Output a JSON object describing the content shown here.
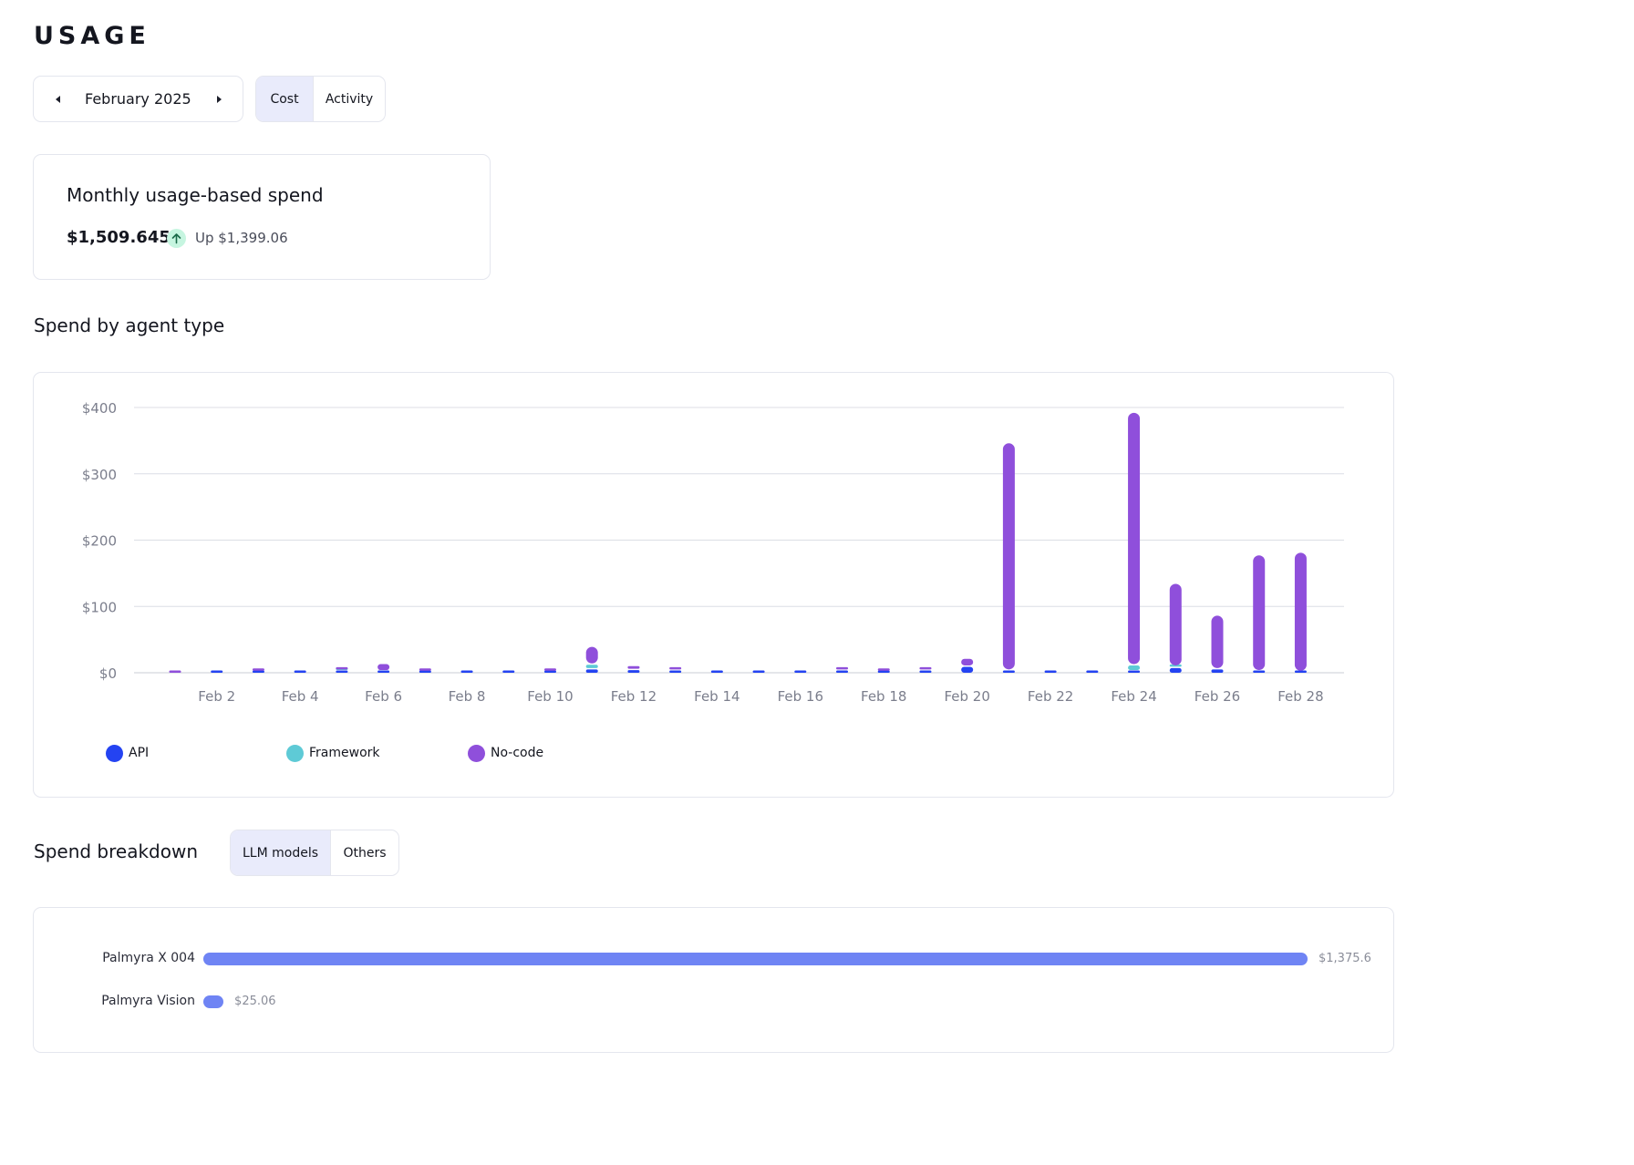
{
  "page": {
    "title": "USAGE"
  },
  "month_picker": {
    "label": "February 2025"
  },
  "view_toggle": {
    "cost": "Cost",
    "activity": "Activity",
    "active": "cost"
  },
  "spend_card": {
    "title": "Monthly usage-based spend",
    "amount": "$1,509.645",
    "change": "Up $1,399.06"
  },
  "agent_section": {
    "title": "Spend by agent type"
  },
  "breakdown_section": {
    "title": "Spend breakdown",
    "tabs": [
      "LLM models",
      "Others"
    ],
    "active_tab": 0
  },
  "colors": {
    "api": "#2443f2",
    "framework": "#5ecad6",
    "nocode": "#8f4fdb",
    "model_bar": "#6f84f4"
  },
  "chart_data": {
    "type": "bar",
    "stacked": true,
    "ylim": [
      0,
      400
    ],
    "yticks": [
      "$0",
      "$100",
      "$200",
      "$300",
      "$400"
    ],
    "ytick_values": [
      0,
      100,
      200,
      300,
      400
    ],
    "categories": [
      "Feb 1",
      "Feb 2",
      "Feb 3",
      "Feb 4",
      "Feb 5",
      "Feb 6",
      "Feb 7",
      "Feb 8",
      "Feb 9",
      "Feb 10",
      "Feb 11",
      "Feb 12",
      "Feb 13",
      "Feb 14",
      "Feb 15",
      "Feb 16",
      "Feb 17",
      "Feb 18",
      "Feb 19",
      "Feb 20",
      "Feb 21",
      "Feb 22",
      "Feb 23",
      "Feb 24",
      "Feb 25",
      "Feb 26",
      "Feb 27",
      "Feb 28"
    ],
    "xtick_labels": [
      "Feb 2",
      "Feb 4",
      "Feb 6",
      "Feb 8",
      "Feb 10",
      "Feb 12",
      "Feb 14",
      "Feb 16",
      "Feb 18",
      "Feb 20",
      "Feb 22",
      "Feb 24",
      "Feb 26",
      "Feb 28"
    ],
    "series": [
      {
        "name": "API",
        "color": "#2443f2",
        "values": [
          0,
          1,
          1,
          3,
          2,
          2,
          1,
          1,
          1,
          1,
          5,
          4,
          3,
          1,
          1,
          1,
          3,
          1,
          3,
          9,
          3,
          1,
          1,
          2,
          7,
          5,
          2,
          1
        ]
      },
      {
        "name": "Framework",
        "color": "#5ecad6",
        "values": [
          0,
          0,
          0,
          0,
          1,
          0,
          0,
          0,
          0,
          0,
          7,
          0,
          0,
          0,
          0,
          0,
          0,
          0,
          0,
          0,
          0,
          0,
          0,
          9,
          2,
          0,
          0,
          0
        ]
      },
      {
        "name": "No-code",
        "color": "#8f4fdb",
        "values": [
          1,
          0,
          4,
          0,
          2,
          11,
          4,
          0,
          0,
          2,
          27,
          6,
          2,
          0,
          0,
          0,
          3,
          3,
          5,
          12,
          343,
          0,
          0,
          381,
          125,
          81,
          175,
          180
        ]
      }
    ]
  },
  "breakdown": {
    "max": 1375.6,
    "models": [
      {
        "name": "Palmyra X 004",
        "value": 1375.6,
        "value_label": "$1,375.6"
      },
      {
        "name": "Palmyra Vision",
        "value": 25.06,
        "value_label": "$25.06"
      }
    ]
  }
}
